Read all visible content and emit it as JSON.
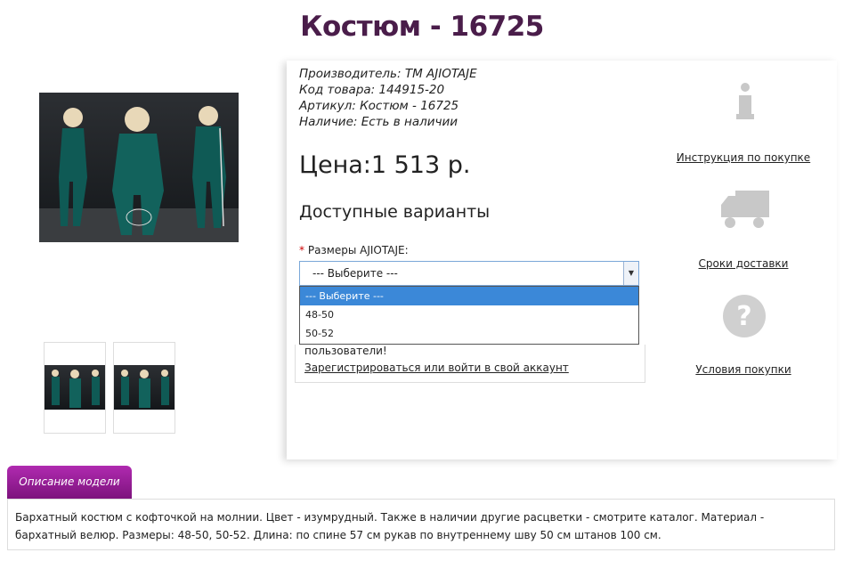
{
  "product": {
    "title": "Костюм - 16725",
    "manufacturer_label": "Производитель:",
    "manufacturer": "ТМ AJIOTAJE",
    "code_label": "Код товара:",
    "code": "144915-20",
    "sku_label": "Артикул:",
    "sku": "Костюм - 16725",
    "stock_label": "Наличие:",
    "stock": "Есть в наличии",
    "price": "Цена:1 513 р."
  },
  "variants": {
    "title": "Доступные варианты",
    "required_mark": "*",
    "sizes_label": "Размеры AJIOTAJE:",
    "selected": "--- Выберите ---",
    "options": [
      "--- Выберите ---",
      "48-50",
      "50-52"
    ]
  },
  "login": {
    "partial_text": "пользователи!",
    "link": "Зарегистрироваться или войти в свой аккаунт"
  },
  "side": {
    "instruction": "Инструкция по покупке",
    "delivery": "Сроки доставки",
    "terms": "Условия покупки"
  },
  "tabs": {
    "description_tab": "Описание модели"
  },
  "description": "Бархатный костюм с кофточкой на молнии. Цвет - изумрудный. Также в наличии другие расцветки - смотрите каталог. Материал - бархатный велюр. Размеры: 48-50, 50-52. Длина: по спине 57 см рукав по внутреннему шву 50 см штанов 100 см.",
  "colors": {
    "title": "#4a1d4a",
    "tab": "#9c1f9c",
    "selected_option": "#3b88d8",
    "suit": "#0f5a55",
    "icon_gray": "#c8c8c8"
  }
}
